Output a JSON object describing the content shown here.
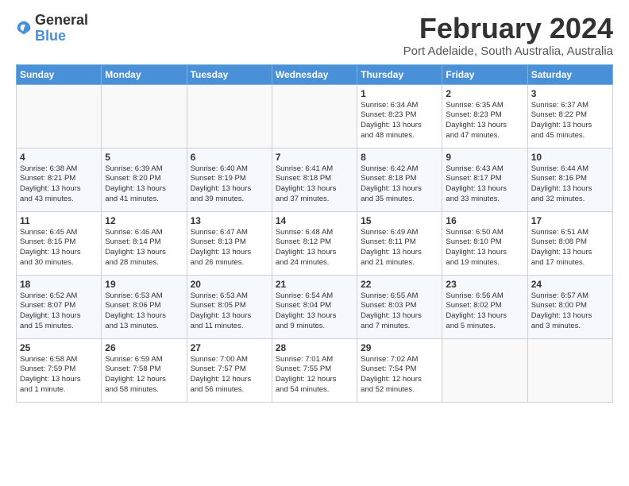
{
  "logo": {
    "line1": "General",
    "line2": "Blue"
  },
  "title": "February 2024",
  "subtitle": "Port Adelaide, South Australia, Australia",
  "days_of_week": [
    "Sunday",
    "Monday",
    "Tuesday",
    "Wednesday",
    "Thursday",
    "Friday",
    "Saturday"
  ],
  "weeks": [
    [
      {
        "day": "",
        "info": ""
      },
      {
        "day": "",
        "info": ""
      },
      {
        "day": "",
        "info": ""
      },
      {
        "day": "",
        "info": ""
      },
      {
        "day": "1",
        "info": "Sunrise: 6:34 AM\nSunset: 8:23 PM\nDaylight: 13 hours\nand 48 minutes."
      },
      {
        "day": "2",
        "info": "Sunrise: 6:35 AM\nSunset: 8:23 PM\nDaylight: 13 hours\nand 47 minutes."
      },
      {
        "day": "3",
        "info": "Sunrise: 6:37 AM\nSunset: 8:22 PM\nDaylight: 13 hours\nand 45 minutes."
      }
    ],
    [
      {
        "day": "4",
        "info": "Sunrise: 6:38 AM\nSunset: 8:21 PM\nDaylight: 13 hours\nand 43 minutes."
      },
      {
        "day": "5",
        "info": "Sunrise: 6:39 AM\nSunset: 8:20 PM\nDaylight: 13 hours\nand 41 minutes."
      },
      {
        "day": "6",
        "info": "Sunrise: 6:40 AM\nSunset: 8:19 PM\nDaylight: 13 hours\nand 39 minutes."
      },
      {
        "day": "7",
        "info": "Sunrise: 6:41 AM\nSunset: 8:18 PM\nDaylight: 13 hours\nand 37 minutes."
      },
      {
        "day": "8",
        "info": "Sunrise: 6:42 AM\nSunset: 8:18 PM\nDaylight: 13 hours\nand 35 minutes."
      },
      {
        "day": "9",
        "info": "Sunrise: 6:43 AM\nSunset: 8:17 PM\nDaylight: 13 hours\nand 33 minutes."
      },
      {
        "day": "10",
        "info": "Sunrise: 6:44 AM\nSunset: 8:16 PM\nDaylight: 13 hours\nand 32 minutes."
      }
    ],
    [
      {
        "day": "11",
        "info": "Sunrise: 6:45 AM\nSunset: 8:15 PM\nDaylight: 13 hours\nand 30 minutes."
      },
      {
        "day": "12",
        "info": "Sunrise: 6:46 AM\nSunset: 8:14 PM\nDaylight: 13 hours\nand 28 minutes."
      },
      {
        "day": "13",
        "info": "Sunrise: 6:47 AM\nSunset: 8:13 PM\nDaylight: 13 hours\nand 26 minutes."
      },
      {
        "day": "14",
        "info": "Sunrise: 6:48 AM\nSunset: 8:12 PM\nDaylight: 13 hours\nand 24 minutes."
      },
      {
        "day": "15",
        "info": "Sunrise: 6:49 AM\nSunset: 8:11 PM\nDaylight: 13 hours\nand 21 minutes."
      },
      {
        "day": "16",
        "info": "Sunrise: 6:50 AM\nSunset: 8:10 PM\nDaylight: 13 hours\nand 19 minutes."
      },
      {
        "day": "17",
        "info": "Sunrise: 6:51 AM\nSunset: 8:08 PM\nDaylight: 13 hours\nand 17 minutes."
      }
    ],
    [
      {
        "day": "18",
        "info": "Sunrise: 6:52 AM\nSunset: 8:07 PM\nDaylight: 13 hours\nand 15 minutes."
      },
      {
        "day": "19",
        "info": "Sunrise: 6:53 AM\nSunset: 8:06 PM\nDaylight: 13 hours\nand 13 minutes."
      },
      {
        "day": "20",
        "info": "Sunrise: 6:53 AM\nSunset: 8:05 PM\nDaylight: 13 hours\nand 11 minutes."
      },
      {
        "day": "21",
        "info": "Sunrise: 6:54 AM\nSunset: 8:04 PM\nDaylight: 13 hours\nand 9 minutes."
      },
      {
        "day": "22",
        "info": "Sunrise: 6:55 AM\nSunset: 8:03 PM\nDaylight: 13 hours\nand 7 minutes."
      },
      {
        "day": "23",
        "info": "Sunrise: 6:56 AM\nSunset: 8:02 PM\nDaylight: 13 hours\nand 5 minutes."
      },
      {
        "day": "24",
        "info": "Sunrise: 6:57 AM\nSunset: 8:00 PM\nDaylight: 13 hours\nand 3 minutes."
      }
    ],
    [
      {
        "day": "25",
        "info": "Sunrise: 6:58 AM\nSunset: 7:59 PM\nDaylight: 13 hours\nand 1 minute."
      },
      {
        "day": "26",
        "info": "Sunrise: 6:59 AM\nSunset: 7:58 PM\nDaylight: 12 hours\nand 58 minutes."
      },
      {
        "day": "27",
        "info": "Sunrise: 7:00 AM\nSunset: 7:57 PM\nDaylight: 12 hours\nand 56 minutes."
      },
      {
        "day": "28",
        "info": "Sunrise: 7:01 AM\nSunset: 7:55 PM\nDaylight: 12 hours\nand 54 minutes."
      },
      {
        "day": "29",
        "info": "Sunrise: 7:02 AM\nSunset: 7:54 PM\nDaylight: 12 hours\nand 52 minutes."
      },
      {
        "day": "",
        "info": ""
      },
      {
        "day": "",
        "info": ""
      }
    ]
  ]
}
